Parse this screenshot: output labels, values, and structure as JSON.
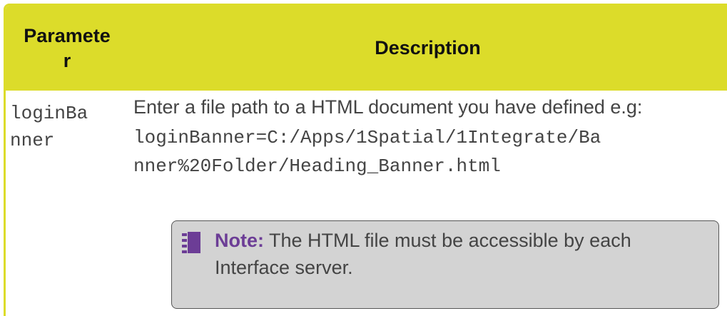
{
  "table": {
    "header": {
      "parameter": "Paramete\nr",
      "description": "Description"
    },
    "row": {
      "parameter": "loginBa\nnner",
      "description": "Enter a file path to a HTML document you have defined e.g:",
      "code": "loginBanner=C:/Apps/1Spatial/1Integrate/Ba\nnner%20Folder/Heading_Banner.html"
    },
    "note": {
      "icon": "notebook-icon",
      "label": "Note:",
      "text": " The HTML file must be accessible by each Interface server."
    }
  },
  "colors": {
    "header_bg": "#dcdc2a",
    "note_bg": "#d3d3d3",
    "note_label": "#6c3d96",
    "text": "#444444"
  }
}
